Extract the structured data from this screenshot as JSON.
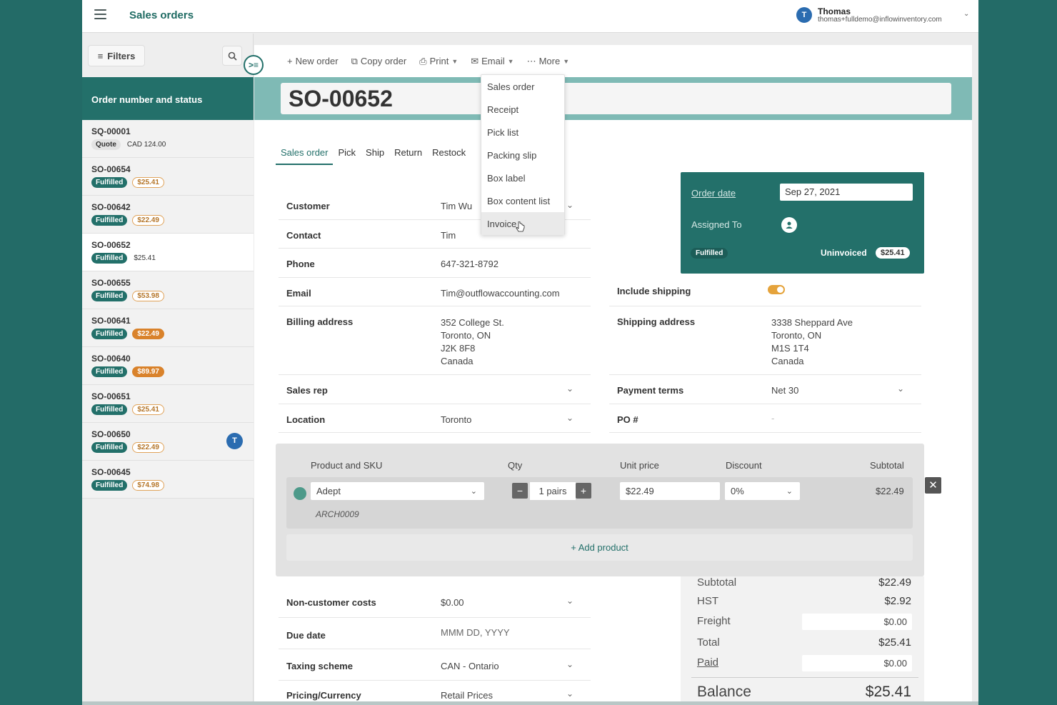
{
  "header": {
    "title": "Sales orders",
    "user_initial": "T",
    "user_name": "Thomas",
    "user_email": "thomas+fulldemo@inflowinventory.com"
  },
  "sidebar": {
    "filters_label": "Filters",
    "list_header": "Order number and status",
    "orders": [
      {
        "number": "SQ-00001",
        "status": "Quote",
        "amount": "CAD 124.00",
        "amount_style": "plain"
      },
      {
        "number": "SO-00654",
        "status": "Fulfilled",
        "amount": "$25.41",
        "amount_style": "outline"
      },
      {
        "number": "SO-00642",
        "status": "Fulfilled",
        "amount": "$22.49",
        "amount_style": "outline"
      },
      {
        "number": "SO-00652",
        "status": "Fulfilled",
        "amount": "$25.41",
        "amount_style": "plain"
      },
      {
        "number": "SO-00655",
        "status": "Fulfilled",
        "amount": "$53.98",
        "amount_style": "outline"
      },
      {
        "number": "SO-00641",
        "status": "Fulfilled",
        "amount": "$22.49",
        "amount_style": "solid"
      },
      {
        "number": "SO-00640",
        "status": "Fulfilled",
        "amount": "$89.97",
        "amount_style": "solid"
      },
      {
        "number": "SO-00651",
        "status": "Fulfilled",
        "amount": "$25.41",
        "amount_style": "outline"
      },
      {
        "number": "SO-00650",
        "status": "Fulfilled",
        "amount": "$22.49",
        "amount_style": "outline",
        "avatar": "T"
      },
      {
        "number": "SO-00645",
        "status": "Fulfilled",
        "amount": "$74.98",
        "amount_style": "outline"
      }
    ],
    "active_order": "SO-00652"
  },
  "toolbar": {
    "new_order": "New order",
    "copy_order": "Copy order",
    "print": "Print",
    "email": "Email",
    "more": "More"
  },
  "email_menu": {
    "items": [
      "Sales order",
      "Receipt",
      "Pick list",
      "Packing slip",
      "Box label",
      "Box content list",
      "Invoice"
    ],
    "hovered": "Invoice"
  },
  "order": {
    "number": "SO-00652",
    "tabs": [
      "Sales order",
      "Pick",
      "Ship",
      "Return",
      "Restock"
    ],
    "active_tab": "Sales order"
  },
  "fields": {
    "customer_label": "Customer",
    "customer": "Tim Wu",
    "contact_label": "Contact",
    "contact": "Tim",
    "phone_label": "Phone",
    "phone": "647-321-8792",
    "email_label": "Email",
    "email": "Tim@outflowaccounting.com",
    "billing_label": "Billing address",
    "billing": [
      "352 College St.",
      "Toronto, ON",
      "J2K 8F8",
      "Canada"
    ],
    "sales_rep_label": "Sales rep",
    "sales_rep": "",
    "location_label": "Location",
    "location": "Toronto",
    "include_shipping_label": "Include shipping",
    "include_shipping": true,
    "shipping_label": "Shipping address",
    "shipping": [
      "3338 Sheppard Ave",
      "Toronto, ON",
      "M1S 1T4",
      "Canada"
    ],
    "payment_terms_label": "Payment terms",
    "payment_terms": "Net 30",
    "po_label": "PO #",
    "po": "-"
  },
  "order_info": {
    "order_date_label": "Order date",
    "order_date": "Sep 27, 2021",
    "assigned_label": "Assigned To",
    "status": "Fulfilled",
    "invoice_status": "Uninvoiced",
    "amount": "$25.41"
  },
  "products": {
    "headers": {
      "product": "Product and SKU",
      "qty": "Qty",
      "unit_price": "Unit price",
      "discount": "Discount",
      "subtotal": "Subtotal"
    },
    "rows": [
      {
        "product": "Adept",
        "sku": "ARCH0009",
        "qty": "1 pairs",
        "unit_price": "$22.49",
        "discount": "0%",
        "subtotal": "$22.49"
      }
    ],
    "add_label": "+ Add product"
  },
  "lower_fields": {
    "non_customer_costs_label": "Non-customer costs",
    "non_customer_costs": "$0.00",
    "due_date_label": "Due date",
    "due_date_placeholder": "MMM DD, YYYY",
    "taxing_scheme_label": "Taxing scheme",
    "taxing_scheme": "CAN - Ontario",
    "pricing_label": "Pricing/Currency",
    "pricing": "Retail Prices"
  },
  "totals": {
    "subtotal_label": "Subtotal",
    "subtotal": "$22.49",
    "hst_label": "HST",
    "hst": "$2.92",
    "freight_label": "Freight",
    "freight": "$0.00",
    "total_label": "Total",
    "total": "$25.41",
    "paid_label": "Paid",
    "paid": "$0.00",
    "balance_label": "Balance",
    "balance": "$25.41"
  },
  "colors": {
    "brand": "#23706a",
    "band": "#7fbab5",
    "accent_orange": "#d9822b",
    "avatar_blue": "#2b6cb0"
  }
}
